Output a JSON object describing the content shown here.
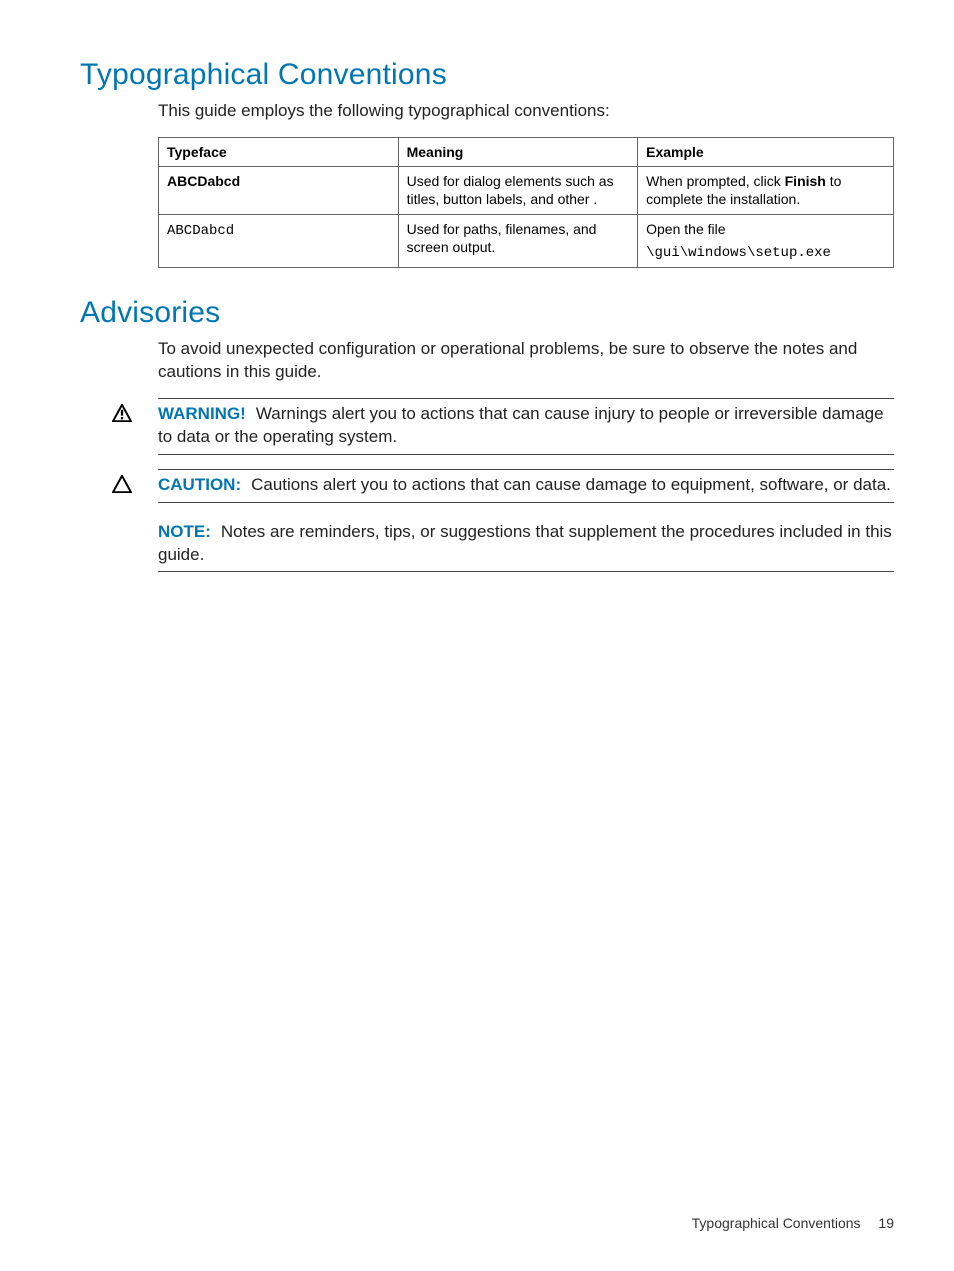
{
  "section1": {
    "heading": "Typographical Conventions",
    "intro": "This guide employs the following typographical conventions:",
    "table": {
      "headers": {
        "c1": "Typeface",
        "c2": "Meaning",
        "c3": "Example"
      },
      "row1": {
        "typeface": "ABCDabcd",
        "meaning": "Used for dialog elements such as titles, button labels, and other .",
        "ex_pre": "When prompted, click ",
        "ex_bold": "Finish",
        "ex_post": " to complete the installation."
      },
      "row2": {
        "typeface": "ABCDabcd",
        "meaning": "Used for paths, filenames, and screen output.",
        "ex_line1": "Open the file",
        "ex_line2": "\\gui\\windows\\setup.exe"
      }
    }
  },
  "section2": {
    "heading": "Advisories",
    "intro": "To avoid unexpected configuration or operational problems, be sure to observe the notes and cautions in this guide.",
    "warning": {
      "label": "WARNING!",
      "text": "Warnings alert you to actions that can cause injury to people or irreversible damage to data or the operating system."
    },
    "caution": {
      "label": "CAUTION:",
      "text": "Cautions alert you to actions that can cause damage to equipment, software, or data."
    },
    "note": {
      "label": "NOTE:",
      "text": "Notes are reminders, tips, or suggestions that supplement the procedures included in this guide."
    }
  },
  "footer": {
    "title": "Typographical Conventions",
    "page": "19"
  }
}
